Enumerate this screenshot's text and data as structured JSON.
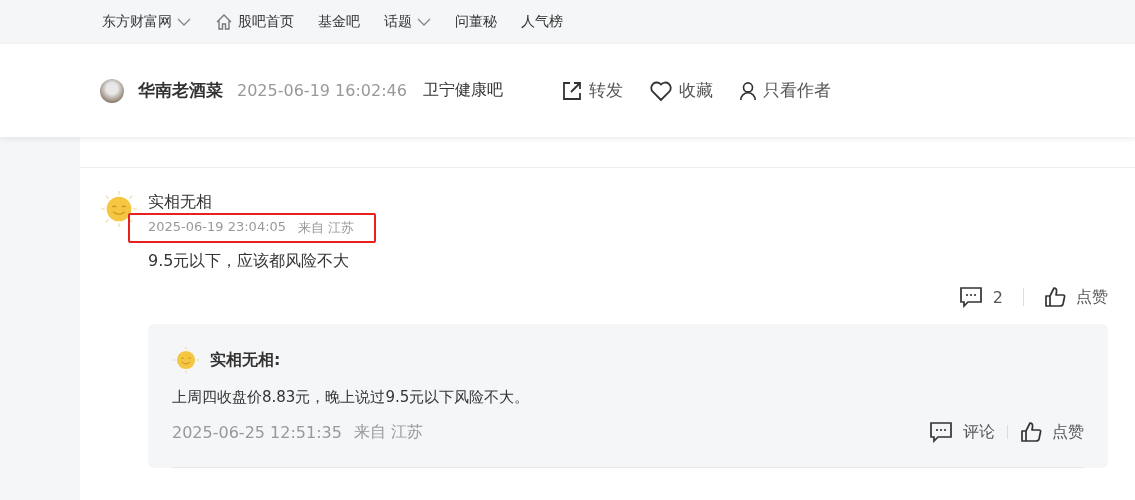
{
  "top_nav": {
    "items": [
      {
        "label": "东方财富网",
        "kind": "dropdown"
      },
      {
        "label": "股吧首页",
        "kind": "home"
      },
      {
        "label": "基金吧",
        "kind": "plain"
      },
      {
        "label": "话题",
        "kind": "dropdown"
      },
      {
        "label": "问董秘",
        "kind": "plain"
      },
      {
        "label": "人气榜",
        "kind": "plain"
      }
    ]
  },
  "post_header": {
    "author": "华南老酒菜",
    "time": "2025-06-19 16:02:46",
    "bar": "卫宁健康吧",
    "actions": [
      {
        "label": "转发",
        "kind": "share"
      },
      {
        "label": "收藏",
        "kind": "favorite"
      },
      {
        "label": "只看作者",
        "kind": "author"
      }
    ]
  },
  "comment": {
    "author": "实相无相",
    "time": "2025-06-19 23:04:05",
    "location": "来自 江苏",
    "highlighted": true,
    "text": "9.5元以下，应该都风险不大",
    "reply_count": "2",
    "like_label": "点赞",
    "reply": {
      "author": "实相无相:",
      "text": "上周四收盘价8.83元，晚上说过9.5元以下风险不大。",
      "time": "2025-06-25 12:51:35",
      "location": "来自 江苏",
      "comment_label": "评论",
      "like_label": "点赞"
    }
  }
}
